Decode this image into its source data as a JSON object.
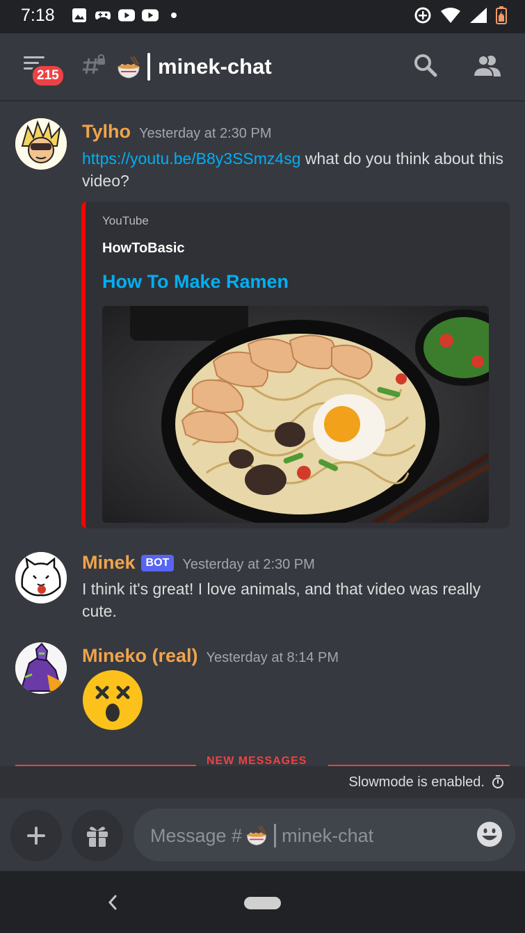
{
  "status_bar": {
    "time": "7:18"
  },
  "header": {
    "unread_badge": "215",
    "channel_name": "minek-chat"
  },
  "messages": [
    {
      "author": "Tylho",
      "timestamp": "Yesterday at 2:30 PM",
      "link": "https://youtu.be/B8y3SSmz4sg",
      "text": " what do you think about this video?",
      "author_color": "#f0a44c",
      "embed": {
        "provider": "YouTube",
        "author": "HowToBasic",
        "title": "How To Make Ramen",
        "border_color": "#ff0000"
      }
    },
    {
      "author": "Minek",
      "bot_tag": "BOT",
      "timestamp": "Yesterday at 2:30 PM",
      "text": "I think it's great! I love animals, and that video was really cute."
    },
    {
      "author": "Mineko (real)",
      "timestamp": "Yesterday at 8:14 PM",
      "emoji": "dizzy-face-emoji"
    }
  ],
  "divider": {
    "label": "NEW MESSAGES"
  },
  "slowmode": {
    "text": "Slowmode is enabled."
  },
  "composer": {
    "placeholder_prefix": "Message #",
    "placeholder_channel": "minek-chat"
  },
  "colors": {
    "background": "#36393f",
    "accent_link": "#00aff4",
    "mention_red": "#ed4245",
    "bot_tag": "#5865f2"
  }
}
